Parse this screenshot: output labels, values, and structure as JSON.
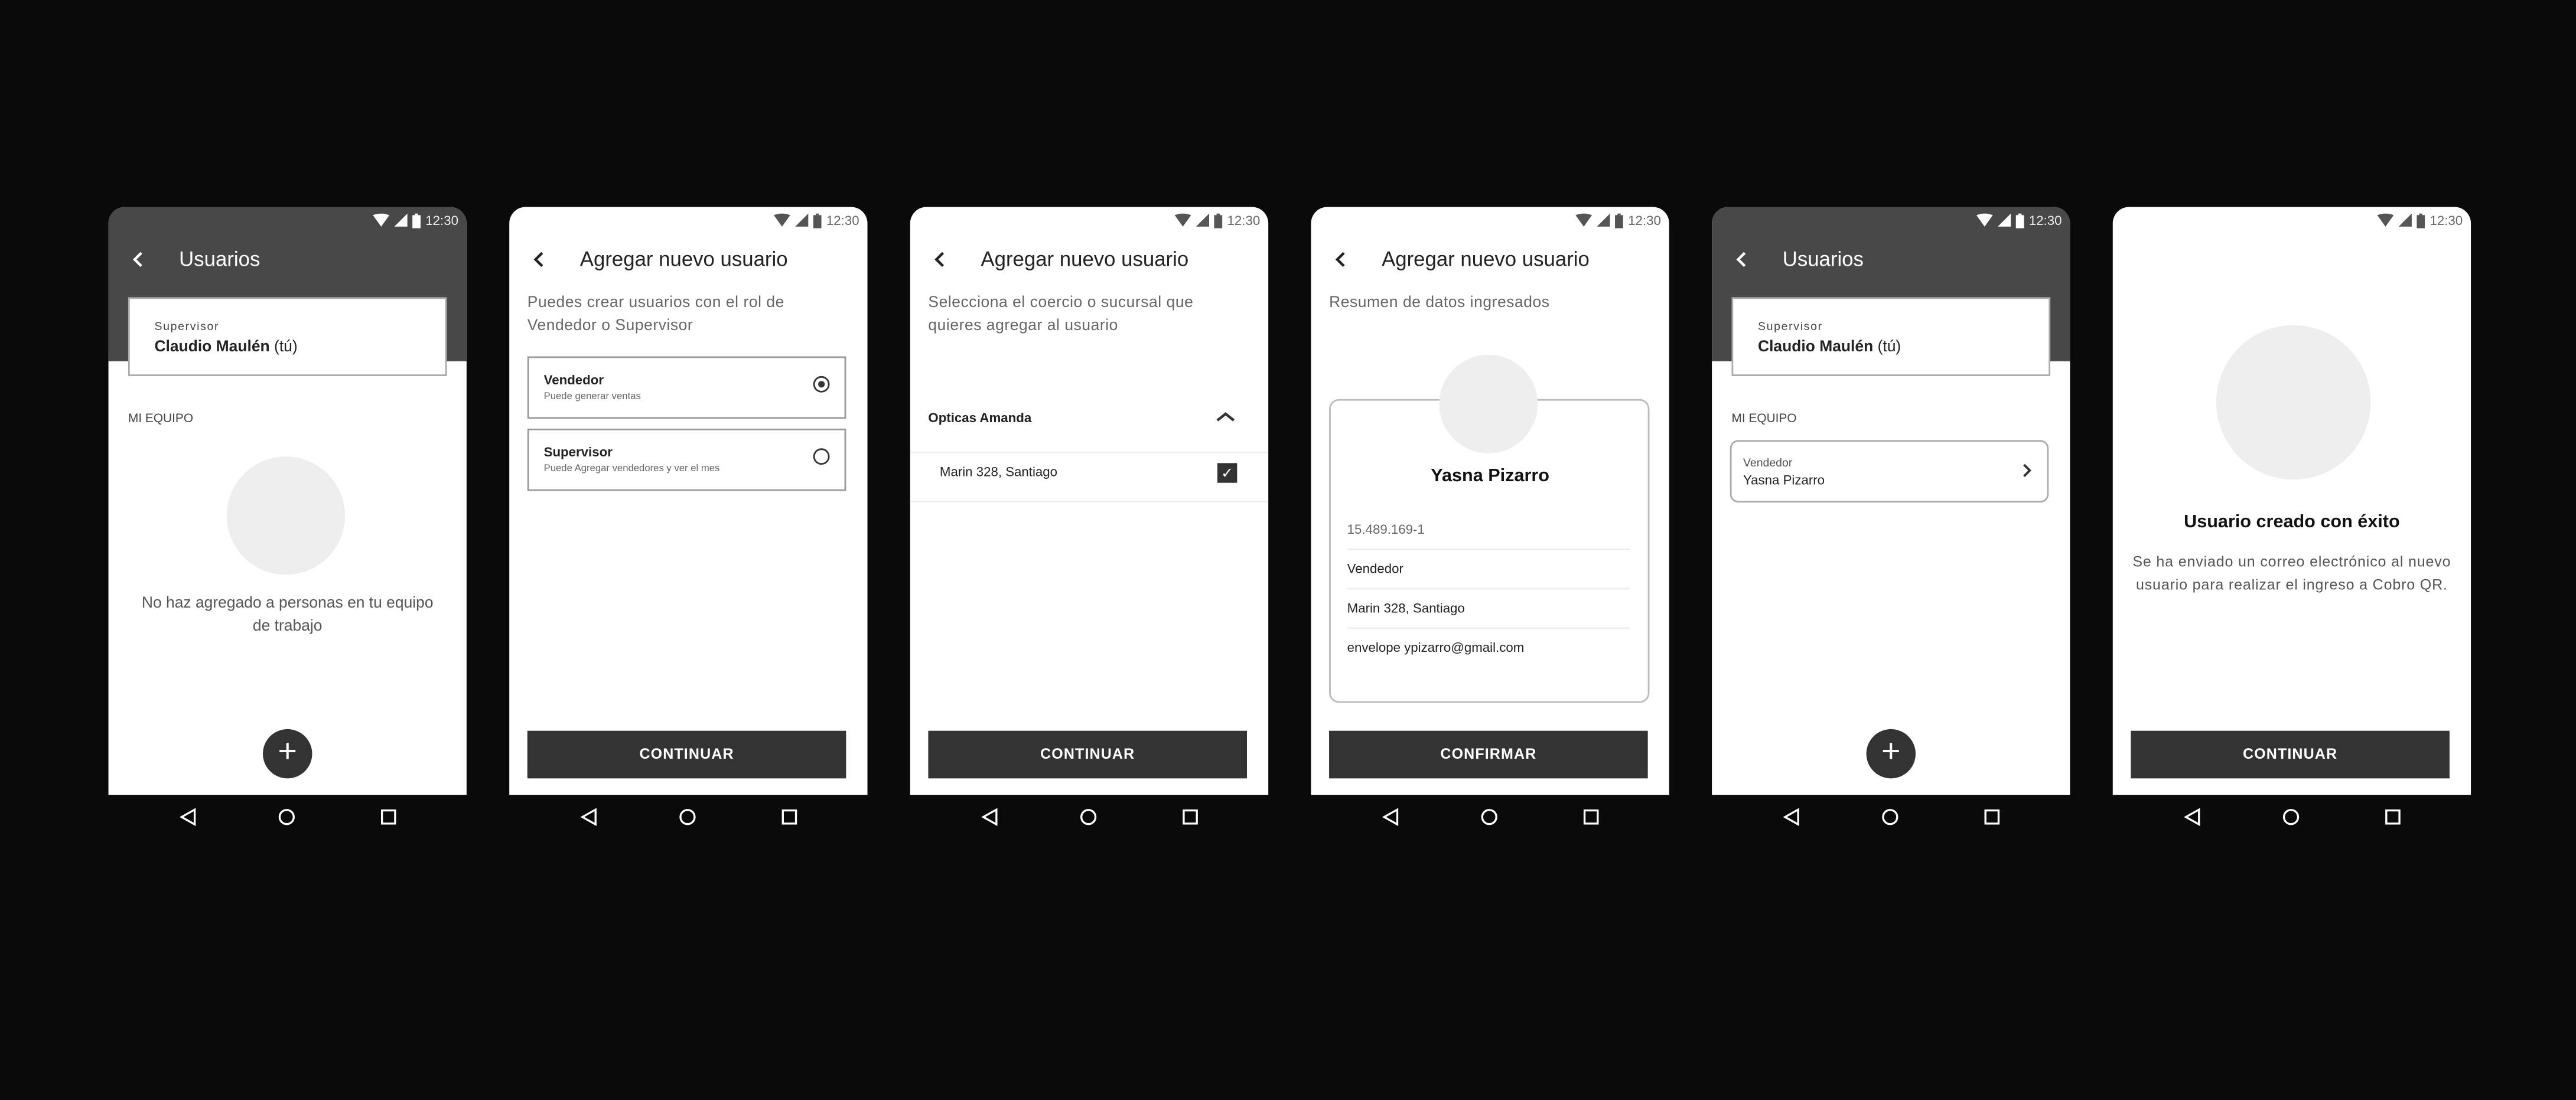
{
  "status_bar": {
    "time": "12:30",
    "icons": [
      "wifi-icon",
      "signal-icon",
      "battery-icon"
    ]
  },
  "nav_bar": {
    "icons": [
      "back-triangle-icon",
      "home-circle-icon",
      "recents-square-icon"
    ]
  },
  "colors": {
    "header_dark": "#484848",
    "button": "#333333",
    "placeholder": "#eeeeee"
  },
  "screens": [
    {
      "title": "Usuarios",
      "current_user": {
        "role": "Supervisor",
        "name": "Claudio Maulén",
        "suffix": "(tú)"
      },
      "section": "MI EQUIPO",
      "empty_message": "No haz agregado a personas en tu equipo de trabajo",
      "fab": "+"
    },
    {
      "title": "Agregar nuevo usuario",
      "subtitle": "Puedes crear usuarios con el rol de Vendedor o Supervisor",
      "options": [
        {
          "title": "Vendedor",
          "description": "Puede generar ventas",
          "selected": true
        },
        {
          "title": "Supervisor",
          "description": "Puede Agregar vendedores y ver el mes",
          "selected": false
        }
      ],
      "button": "CONTINUAR"
    },
    {
      "title": "Agregar nuevo usuario",
      "subtitle": "Selecciona el coercio o sucursal que quieres agregar al usuario",
      "group": "Opticas Amanda",
      "items": [
        {
          "label": "Marin 328, Santiago",
          "checked": true
        }
      ],
      "button": "CONTINUAR"
    },
    {
      "title": "Agregar nuevo usuario",
      "subtitle": "Resumen de datos ingresados",
      "name": "Yasna Pizarro",
      "rut": "15.489.169-1",
      "role": "Vendedor",
      "branch": "Marin 328, Santiago",
      "email": "envelope ypizarro@gmail.com",
      "button": "CONFIRMAR"
    },
    {
      "title": "Usuarios",
      "current_user": {
        "role": "Supervisor",
        "name": "Claudio Maulén",
        "suffix": "(tú)"
      },
      "section": "MI EQUIPO",
      "team": [
        {
          "role": "Vendedor",
          "name": "Yasna Pizarro"
        }
      ],
      "fab": "+"
    },
    {
      "title": "Usuario creado con éxito",
      "message": "Se ha enviado un correo electrónico al nuevo usuario para realizar el ingreso a Cobro QR.",
      "button": "CONTINUAR"
    }
  ]
}
